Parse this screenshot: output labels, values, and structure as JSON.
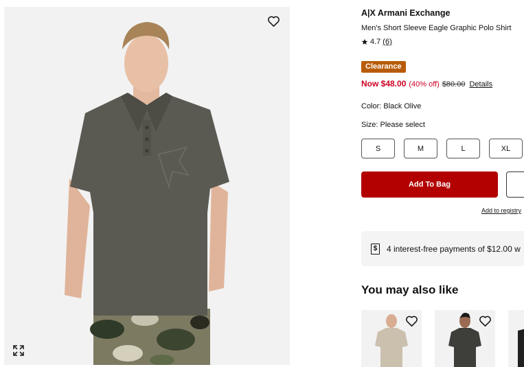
{
  "product": {
    "brand": "A|X Armani Exchange",
    "name": "Men's Short Sleeve Eagle Graphic Polo Shirt",
    "rating": "4.7",
    "review_count": "(6)",
    "badge": "Clearance",
    "price_now": "Now $48.00",
    "discount": "(40% off)",
    "price_original": "$80.00",
    "details_link": "Details",
    "color_label": "Color: Black Olive",
    "size_label": "Size: Please select",
    "sizes": [
      "S",
      "M",
      "L",
      "XL"
    ]
  },
  "actions": {
    "add_to_bag": "Add To Bag",
    "add_to_registry": "Add to registry"
  },
  "payments": {
    "text": "4 interest-free payments of $12.00 w"
  },
  "recommendations": {
    "title": "You may also like"
  },
  "icons": {
    "favorite": "heart-icon",
    "expand": "expand-icon",
    "star": "star-icon",
    "payment": "dollar-sign-icon"
  },
  "colors": {
    "shirt": "#5b5a52",
    "accent_red": "#b30000",
    "sale_red": "#cc0023",
    "clearance_badge": "#b85c0a"
  }
}
